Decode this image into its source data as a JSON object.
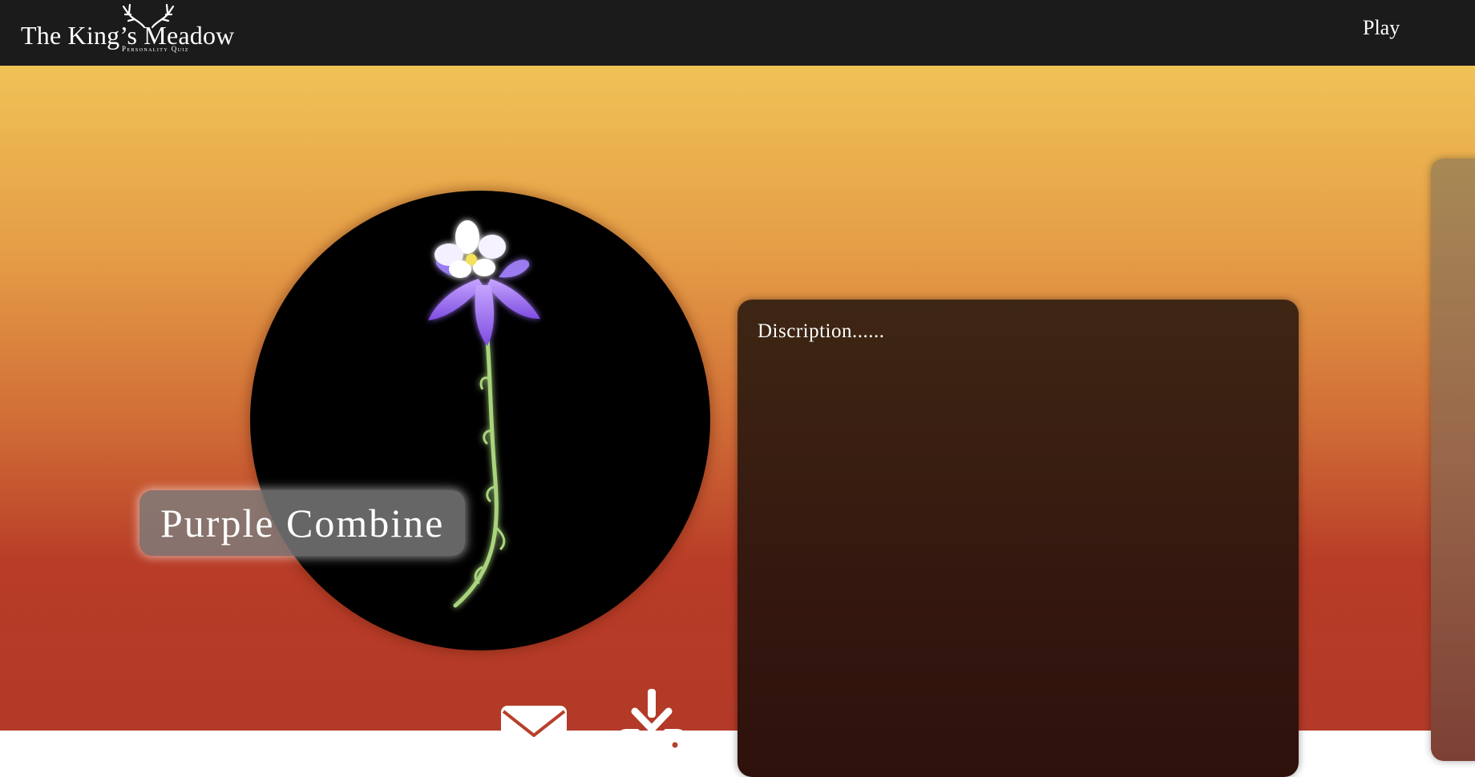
{
  "header": {
    "logo_title": "The King’s Meadow",
    "logo_subtitle": "Personality Quiz",
    "nav_play": "Play"
  },
  "result": {
    "flower_name": "Purple Combine",
    "description": "Discription......"
  },
  "actions": {
    "email_icon": "envelope-icon",
    "download_icon": "download-icon"
  },
  "colors": {
    "header_bg": "#1b1b1b",
    "gradient_top": "#f0c256",
    "gradient_bottom": "#b33a28",
    "panel_bg": "#35180f"
  }
}
